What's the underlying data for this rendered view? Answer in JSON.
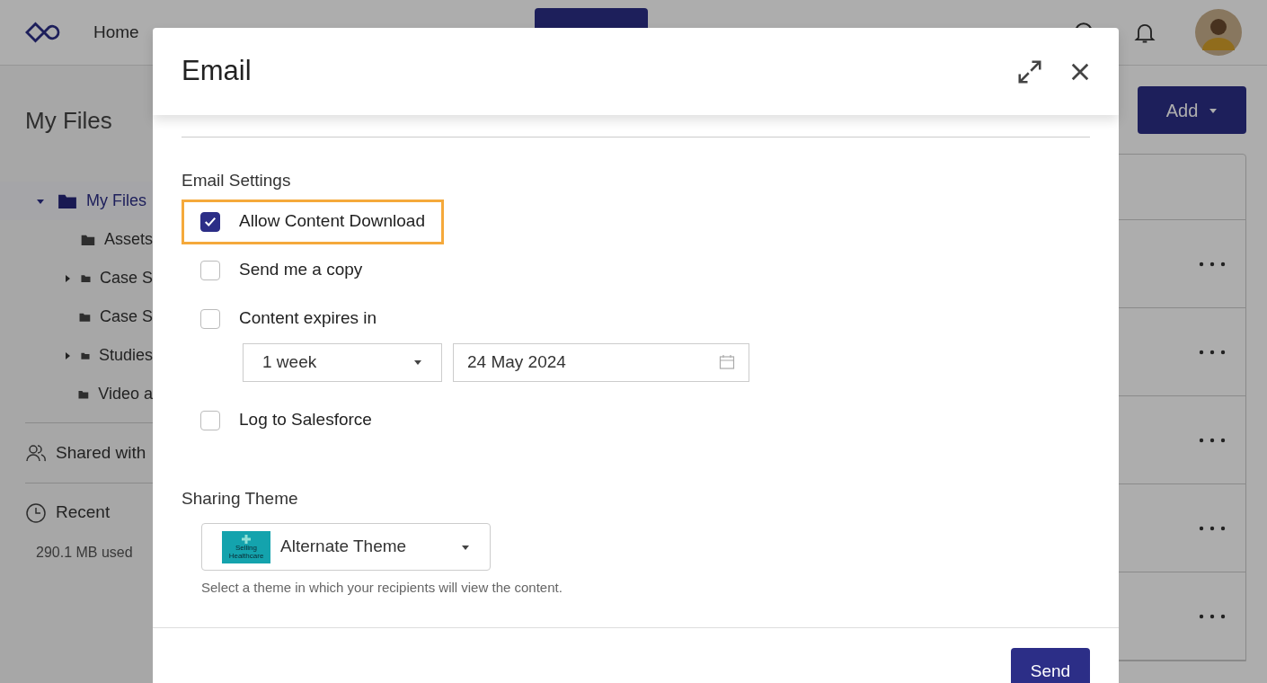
{
  "nav": {
    "items": [
      {
        "label": "Home"
      }
    ]
  },
  "page": {
    "title": "My Files",
    "add_button": "Add"
  },
  "sidebar": {
    "tree": [
      {
        "label": "My Files",
        "selected": true,
        "expanded": true,
        "children": [
          {
            "label": "Assets",
            "selected": false
          },
          {
            "label": "Case S",
            "selected": false,
            "expanded": false
          },
          {
            "label": "Case S",
            "selected": false
          },
          {
            "label": "Studies",
            "selected": false,
            "expanded": false
          },
          {
            "label": "Video a",
            "selected": false
          }
        ]
      }
    ],
    "links": [
      {
        "label": "Shared with",
        "kind": "shared"
      },
      {
        "label": "Recent",
        "kind": "recent"
      }
    ],
    "storage": "290.1 MB used"
  },
  "dialog": {
    "title": "Email",
    "settings_label": "Email Settings",
    "options": [
      {
        "label": "Allow Content Download",
        "checked": true,
        "highlighted": true
      },
      {
        "label": "Send me a copy",
        "checked": false,
        "highlighted": false
      },
      {
        "label": "Content expires in",
        "checked": false,
        "highlighted": false,
        "expiry": {
          "duration": "1 week",
          "date": "24 May 2024"
        }
      },
      {
        "label": "Log to Salesforce",
        "checked": false,
        "highlighted": false
      }
    ],
    "sharing_theme": {
      "label": "Sharing Theme",
      "thumbnail_text": "Selling Healthcare",
      "value": "Alternate Theme",
      "hint": "Select a theme in which your recipients will view the content."
    },
    "send_button": "Send"
  }
}
